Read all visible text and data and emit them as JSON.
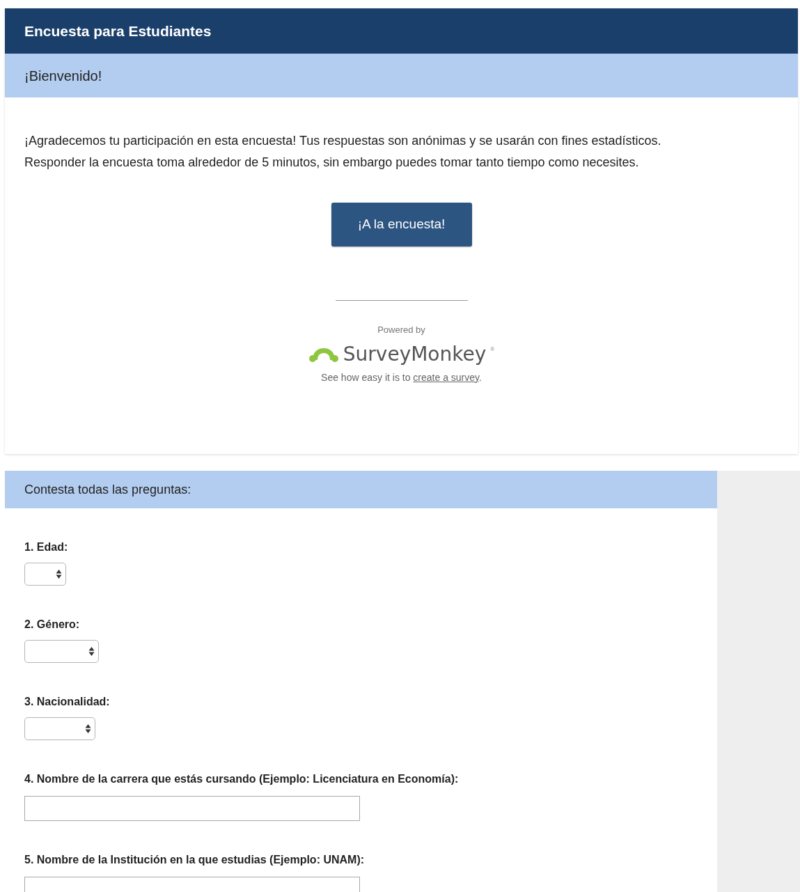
{
  "survey": {
    "title": "Encuesta para Estudiantes"
  },
  "welcome": {
    "heading": "¡Bienvenido!",
    "lines": [
      "¡Agradecemos tu participación en esta encuesta! Tus respuestas son anónimas y se usarán con fines estadísticos.",
      "Responder la encuesta toma alrededor de 5 minutos, sin embargo puedes tomar tanto tiempo como necesites."
    ],
    "button": "¡A la encuesta!"
  },
  "footer": {
    "powered_by": "Powered by",
    "brand": "SurveyMonkey",
    "brand_mark": "®",
    "note": "See how easy it is to ",
    "link": "create a survey",
    "note_end": "."
  },
  "section": {
    "heading": "Contesta todas las preguntas:"
  },
  "questions": [
    {
      "label": "1. Edad:",
      "kind": "select"
    },
    {
      "label": "2. Género:",
      "kind": "select"
    },
    {
      "label": "3. Nacionalidad:",
      "kind": "select"
    },
    {
      "label": "4. Nombre de la carrera que estás cursando (Ejemplo: Licenciatura en Economía):",
      "kind": "text"
    },
    {
      "label": "5. Nombre de la Institución en la que estudias (Ejemplo: UNAM):",
      "kind": "text"
    }
  ]
}
